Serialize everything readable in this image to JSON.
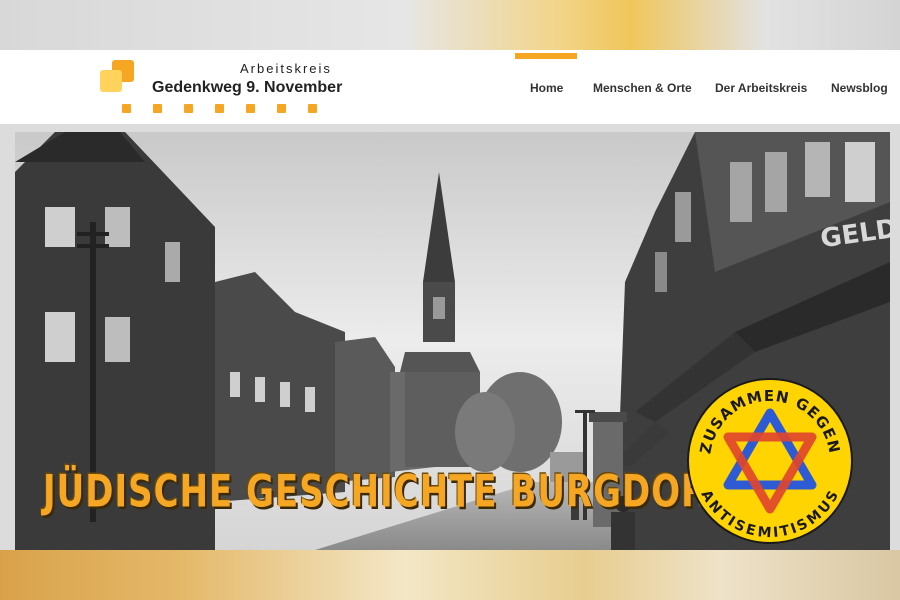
{
  "logo": {
    "top_text": "Arbeitskreis",
    "main_text": "Gedenkweg 9. November"
  },
  "nav": {
    "items": [
      {
        "label": "Home",
        "active": true
      },
      {
        "label": "Menschen & Orte"
      },
      {
        "label": "Der Arbeitskreis"
      },
      {
        "label": "Newsblog"
      }
    ]
  },
  "hero": {
    "title": "JÜDISCHE GESCHICHTE BURGDORF",
    "shop_sign": "GELD"
  },
  "badge": {
    "top_text": "ZUSAMMEN GEGEN",
    "bottom_text": "ANTISEMITISMUS",
    "icon": "star-of-david-icon"
  },
  "colors": {
    "accent": "#f5a623",
    "accent_light": "#ffd35c",
    "badge_yellow": "#ffd400"
  }
}
